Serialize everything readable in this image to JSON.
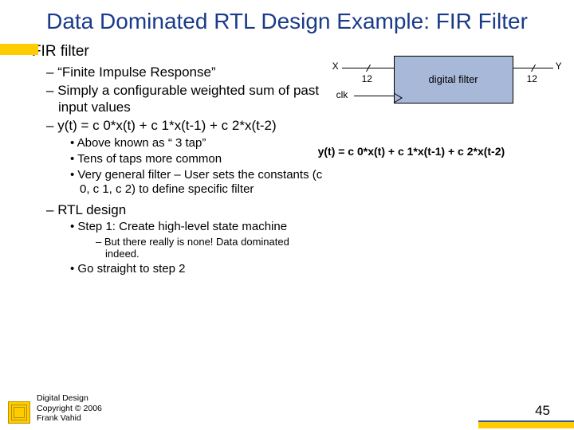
{
  "title": "Data Dominated RTL Design Example: FIR Filter",
  "b1": "FIR filter",
  "b2a": "“Finite Impulse Response”",
  "b2b": "Simply a configurable weighted sum of past input values",
  "b2c": "y(t) = c 0*x(t) + c 1*x(t-1) + c 2*x(t-2)",
  "b3a": "Above known as “ 3 tap”",
  "b3b": "Tens of taps more common",
  "b3c": "Very general filter – User sets the constants (c 0, c 1, c 2) to define specific filter",
  "b2d": "RTL design",
  "b3d": "Step 1: Create high-level state machine",
  "b4a": "But there really is none!  Data dominated indeed.",
  "b3e": "Go straight to step 2",
  "diagram": {
    "x": "X",
    "y": "Y",
    "bus": "12",
    "clk": "clk",
    "box": "digital filter"
  },
  "equation": "y(t) = c 0*x(t) + c 1*x(t-1) + c 2*x(t-2)",
  "footer": {
    "l1": "Digital Design",
    "l2": "Copyright © 2006",
    "l3": "Frank Vahid"
  },
  "page": "45"
}
